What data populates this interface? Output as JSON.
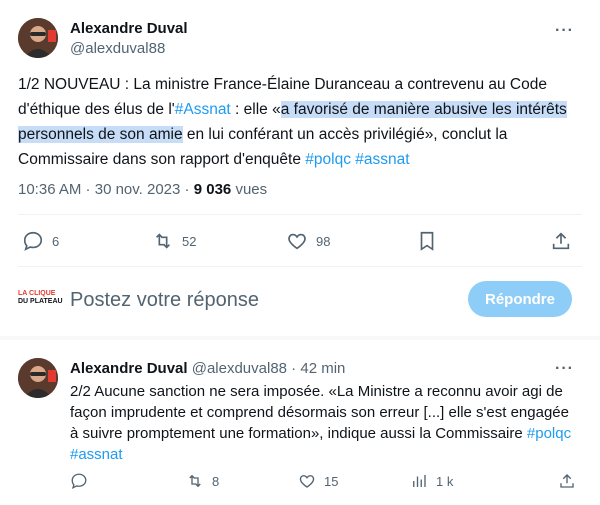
{
  "tweet": {
    "author_name": "Alexandre Duval",
    "author_handle": "@alexduval88",
    "more": "···",
    "text_part1": "1/2 NOUVEAU : La ministre France-Élaine Duranceau a contrevenu au Code d'éthique des élus de l'",
    "hashtag_assnat": "#Assnat",
    "text_part2": " : elle «",
    "text_highlight": "a favorisé de manière abusive les intérêts personnels de son amie",
    "text_part3": " en lui conférant un accès privilégié», conclut la Commissaire dans son rapport d'enquête ",
    "hashtag_polqc": "#polqc",
    "hashtag_assnat2": "#assnat",
    "time": "10:36 AM",
    "date": "30 nov. 2023",
    "sep": " · ",
    "views_count": "9 036",
    "views_label": "vues",
    "actions": {
      "replies": "6",
      "retweets": "52",
      "likes": "98"
    }
  },
  "compose": {
    "logo_line1": "LA CLIQUE",
    "logo_line2": "DU PLATEAU",
    "placeholder": "Postez votre réponse",
    "button_label": "Répondre"
  },
  "reply": {
    "author_name": "Alexandre Duval",
    "author_handle": "@alexduval88",
    "age": "42 min",
    "more": "···",
    "text_main": "2/2 Aucune sanction ne sera imposée. «La Ministre a reconnu avoir agi de façon imprudente et comprend désormais son erreur [...] elle s'est engagée à suivre promptement une formation», indique aussi la Commissaire ",
    "hashtag_polqc": "#polqc",
    "hashtag_assnat": "#assnat",
    "actions": {
      "replies": "",
      "retweets": "8",
      "likes": "15",
      "views": "1 k"
    }
  },
  "colors": {
    "accent": "#1d9bf0",
    "highlight": "#c6dcf7",
    "muted": "#536471"
  }
}
